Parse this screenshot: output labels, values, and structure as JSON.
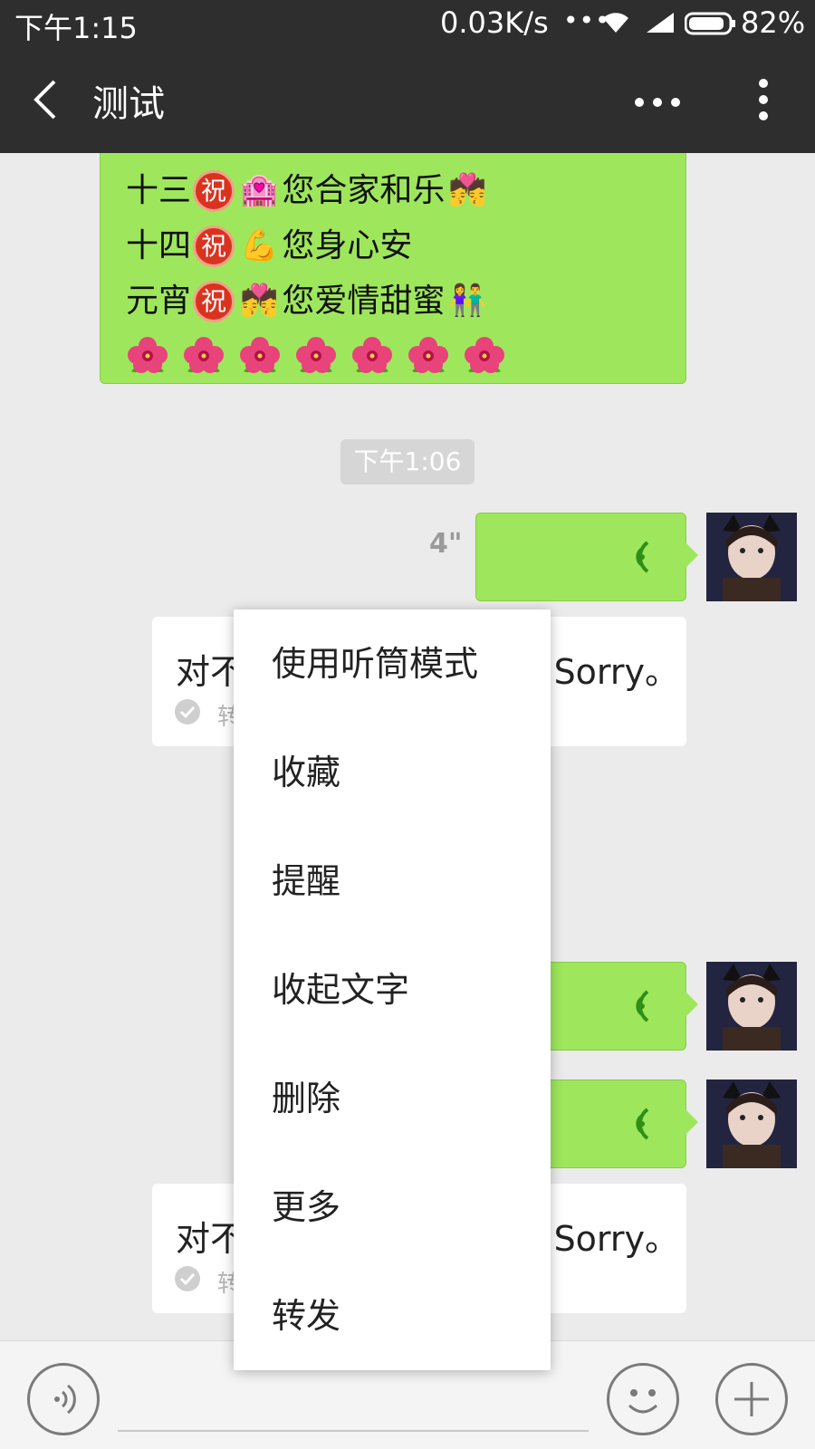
{
  "status_bar": {
    "time": "下午1:15",
    "network_speed": "0.03K/s",
    "dots": "•••",
    "battery_percent": "82%",
    "icons": [
      "wifi-icon",
      "signal-icon",
      "battery-icon"
    ]
  },
  "header": {
    "title": "测试",
    "icons": [
      "back-arrow-icon",
      "more-horizontal-icon",
      "more-vertical-icon"
    ]
  },
  "messages": {
    "blessing": {
      "lines": [
        {
          "prefix": "十三",
          "zhu": "祝",
          "emoji": "🏩",
          "text": "您合家和乐",
          "end_emoji": "💏"
        },
        {
          "prefix": "十四",
          "zhu": "祝",
          "emoji": "💪",
          "text": "您身心安",
          "end_emoji": ""
        },
        {
          "prefix": "元宵",
          "zhu": "祝",
          "emoji": "💏",
          "text": "您爱情甜蜜",
          "end_emoji": "👫"
        }
      ],
      "flower_count": 7
    },
    "timestamp": "下午1:06",
    "voice_1": {
      "duration": "4\""
    },
    "transcript_1": {
      "left_text": "对不",
      "right_text": "Sorry。",
      "sub_text": "转"
    },
    "transcript_2": {
      "left_text": "对不",
      "right_text": "Sorry。",
      "sub_text": "转"
    }
  },
  "context_menu": {
    "items": [
      "使用听筒模式",
      "收藏",
      "提醒",
      "收起文字",
      "删除",
      "更多",
      "转发"
    ]
  },
  "input_bar": {
    "icons": [
      "voice-input-icon",
      "emoji-icon",
      "plus-icon"
    ]
  },
  "colors": {
    "bubble_green": "#9ee75c",
    "bar_dark": "#2e2e2e",
    "chat_bg": "#ebebeb",
    "wave_green": "#2f8f17"
  }
}
